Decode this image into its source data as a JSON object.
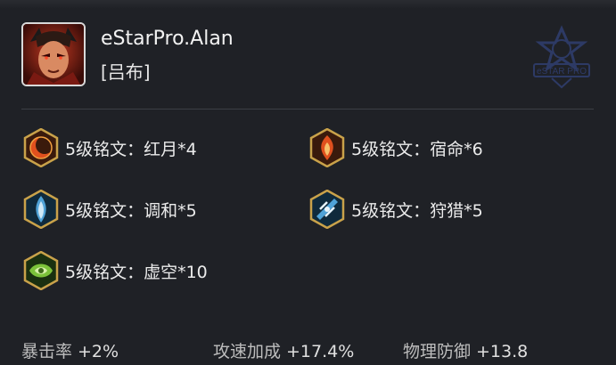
{
  "player": {
    "name": "eStarPro.Alan",
    "hero": "[吕布]"
  },
  "watermark": {
    "text": "eSTAR PRO"
  },
  "runes": [
    {
      "label": "5级铭文：红月*4",
      "color": "red",
      "icon": "red-moon-rune-icon"
    },
    {
      "label": "5级铭文：宿命*6",
      "color": "red",
      "icon": "fate-rune-icon"
    },
    {
      "label": "5级铭文：调和*5",
      "color": "blue",
      "icon": "harmony-rune-icon"
    },
    {
      "label": "5级铭文：狩猎*5",
      "color": "blue",
      "icon": "hunt-rune-icon"
    },
    {
      "label": "5级铭文：虚空*10",
      "color": "green",
      "icon": "void-rune-icon"
    }
  ],
  "stats": [
    {
      "name": "暴击率",
      "value": "+2%"
    },
    {
      "name": "攻速加成",
      "value": "+17.4%"
    },
    {
      "name": "物理防御",
      "value": "+13.8"
    }
  ],
  "colors": {
    "background": "#1f2126",
    "rune_red": "#e0501e",
    "rune_blue": "#4fa3d8",
    "rune_green": "#7cc23a",
    "rune_border": "#c9a24a"
  }
}
